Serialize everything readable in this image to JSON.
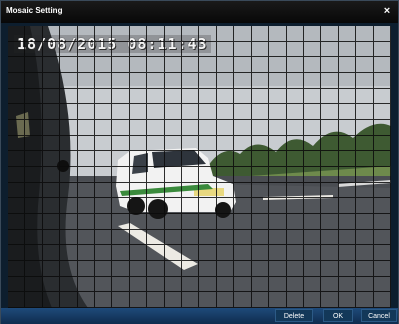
{
  "dialog": {
    "title": "Mosaic Setting",
    "close_glyph": "×"
  },
  "video": {
    "timestamp": "18/08/2015 08:11:43",
    "grid": {
      "columns": 22,
      "rows": 18
    }
  },
  "footer": {
    "delete_label": "Delete",
    "ok_label": "OK",
    "cancel_label": "Cancel"
  },
  "colors": {
    "accent": "#1e4a7a",
    "titlebar": "#0a0a0a",
    "grid_line": "#0a0a0a"
  }
}
